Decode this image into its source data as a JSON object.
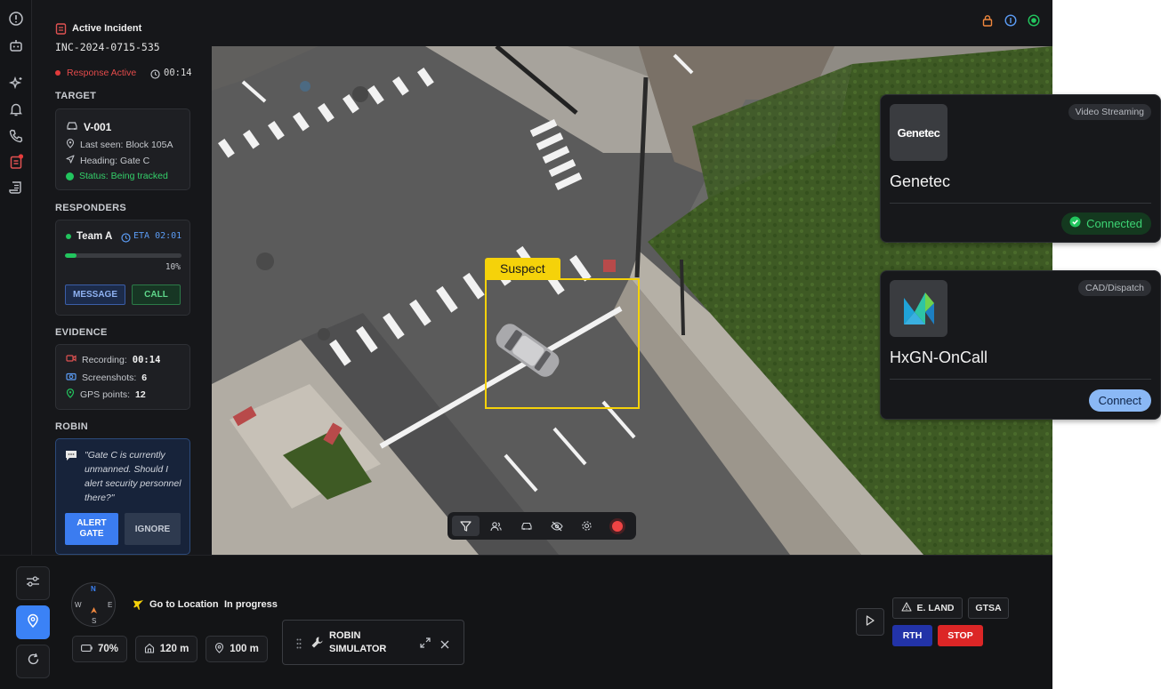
{
  "incident": {
    "label": "Active Incident",
    "id": "INC-2024-0715-535",
    "status": "Response Active",
    "timer": "00:14"
  },
  "target": {
    "section": "TARGET",
    "id": "V-001",
    "last_seen": "Last seen: Block 105A",
    "heading": "Heading: Gate C",
    "status": "Status: Being tracked"
  },
  "responders": {
    "section": "RESPONDERS",
    "team": "Team A",
    "eta": "ETA 02:01",
    "progress_percent": 10,
    "progress_label": "10%",
    "message_label": "MESSAGE",
    "call_label": "CALL"
  },
  "evidence": {
    "section": "EVIDENCE",
    "recording_label": "Recording:",
    "recording_value": "00:14",
    "screenshots_label": "Screenshots:",
    "screenshots_value": "6",
    "gps_label": "GPS points:",
    "gps_value": "12"
  },
  "robin": {
    "section": "ROBIN",
    "message": "\"Gate C is currently unmanned. Should I alert security personnel there?\"",
    "alert_label": "ALERT GATE",
    "ignore_label": "IGNORE"
  },
  "video": {
    "detection_label": "Suspect"
  },
  "mission": {
    "action": "Go to Location",
    "state": "In progress",
    "battery": "70%",
    "altitude": "120 m",
    "distance": "100 m",
    "simulator_label": "ROBIN SIMULATOR",
    "compass": {
      "n": "N",
      "s": "S",
      "e": "E",
      "w": "W"
    }
  },
  "commands": {
    "eland": "E. LAND",
    "gtsa": "GTSA",
    "rth": "RTH",
    "stop": "STOP"
  },
  "integrations": [
    {
      "tag": "Video Streaming",
      "name": "Genetec",
      "logo_text": "Genetec",
      "status": "Connected"
    },
    {
      "tag": "CAD/Dispatch",
      "name": "HxGN-OnCall",
      "action": "Connect"
    }
  ],
  "colors": {
    "accent_blue": "#3b82f6",
    "danger_red": "#dc2626",
    "success_green": "#22c55e",
    "detection_yellow": "#f5d20a"
  }
}
